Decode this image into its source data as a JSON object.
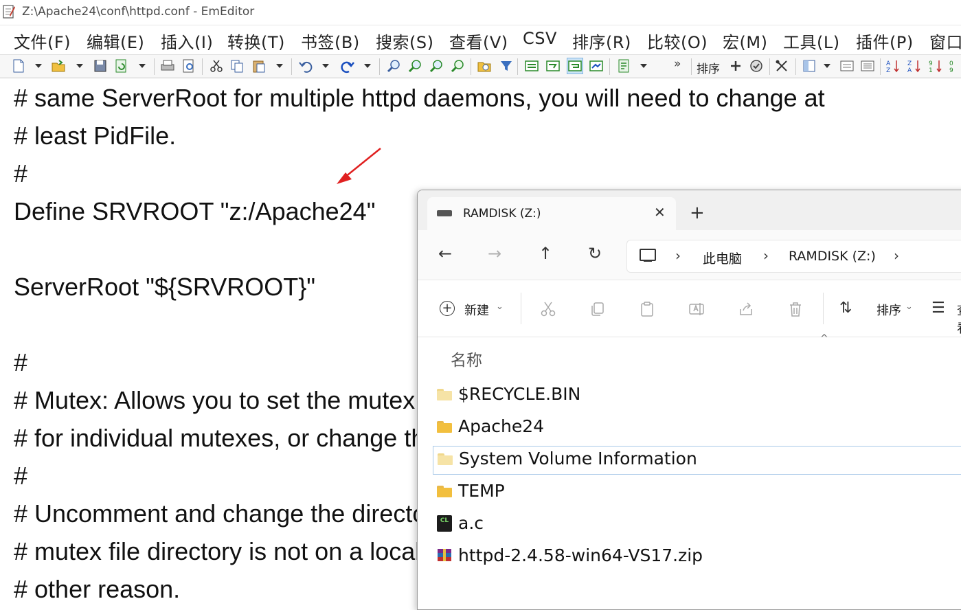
{
  "editor": {
    "window_title": "Z:\\Apache24\\conf\\httpd.conf - EmEditor",
    "menu": [
      "文件(F)",
      "编辑(E)",
      "插入(I)",
      "转换(T)",
      "书签(B)",
      "搜索(S)",
      "查看(V)",
      "CSV",
      "排序(R)",
      "比较(O)",
      "宏(M)",
      "工具(L)",
      "插件(P)",
      "窗口"
    ],
    "toolbar": {
      "sort_label": "排序",
      "overflow": "»"
    },
    "lines": [
      "# same ServerRoot for multiple httpd daemons, you will need to change at",
      "# least PidFile.",
      "#",
      "Define SRVROOT \"z:/Apache24\"",
      "",
      "ServerRoot \"${SRVROOT}\"",
      "",
      "#",
      "# Mutex: Allows you to set the mutex mechanism and mutex file directory",
      "# for individual mutexes, or change the global defaults",
      "#",
      "# Uncomment and change the directory if mutexes are file-based and the default",
      "# mutex file directory is not on a local disk or is not appropriate for some",
      "# other reason."
    ],
    "annotation_color": "#e02020"
  },
  "explorer": {
    "tab": {
      "label": "RAMDISK (Z:)",
      "close": "✕",
      "new_tab": "+"
    },
    "nav": {
      "back": "←",
      "forward": "→",
      "up": "↑",
      "refresh": "↻"
    },
    "breadcrumb": {
      "sep": "›",
      "items": [
        "此电脑",
        "RAMDISK (Z:)"
      ]
    },
    "commands": {
      "new_label": "新建",
      "sort_label": "排序",
      "view_label": "查看"
    },
    "column_name": "名称",
    "files": [
      {
        "name": "$RECYCLE.BIN",
        "type": "folder-system"
      },
      {
        "name": "Apache24",
        "type": "folder"
      },
      {
        "name": "System Volume Information",
        "type": "folder-system",
        "selected": true
      },
      {
        "name": "TEMP",
        "type": "folder"
      },
      {
        "name": "a.c",
        "type": "c-source"
      },
      {
        "name": "httpd-2.4.58-win64-VS17.zip",
        "type": "zip"
      }
    ]
  }
}
